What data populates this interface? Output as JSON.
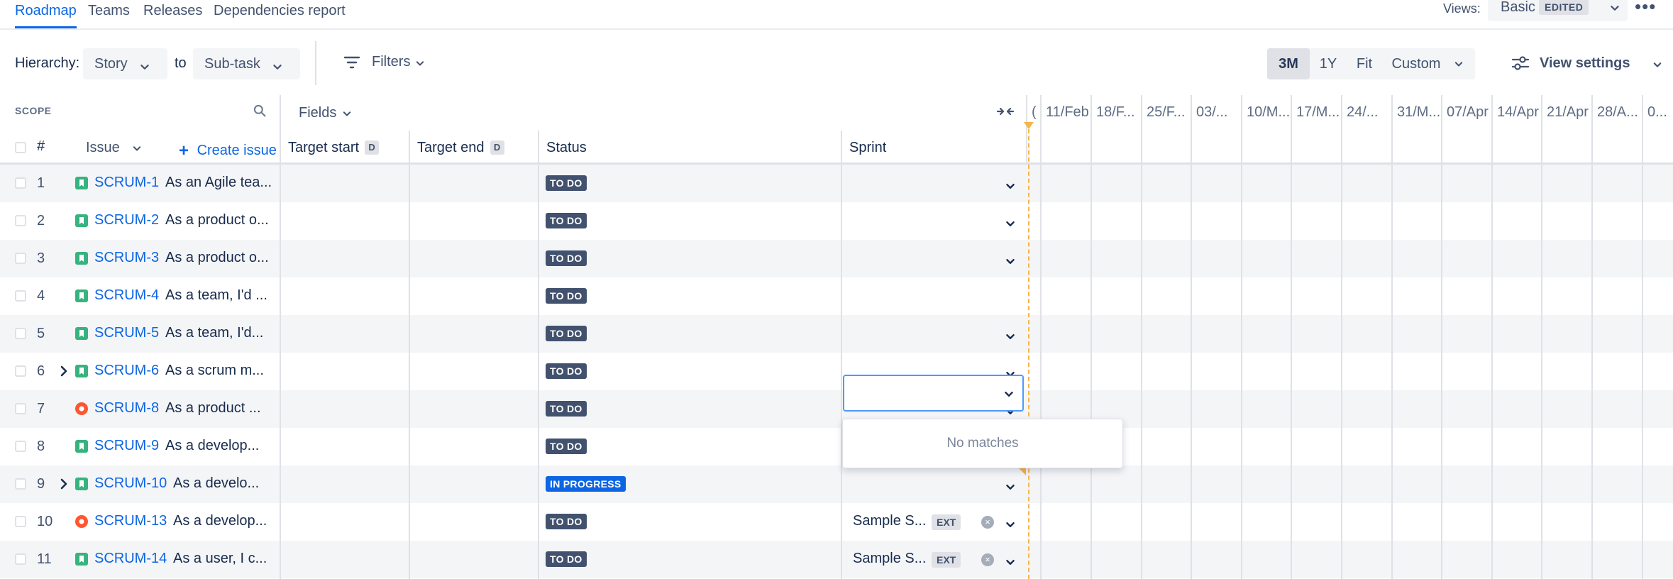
{
  "nav": {
    "tabs": [
      "Roadmap",
      "Teams",
      "Releases",
      "Dependencies report"
    ],
    "views_label": "Views:",
    "views_value": "Basic",
    "views_badge": "EDITED",
    "more": "•••"
  },
  "toolbar": {
    "hierarchy_label": "Hierarchy:",
    "from_value": "Story",
    "to_label": "to",
    "to_value": "Sub-task",
    "filters": "Filters",
    "zoom_options": [
      "3M",
      "1Y",
      "Fit",
      "Custom"
    ],
    "zoom_selected": "3M",
    "view_settings": "View settings"
  },
  "table": {
    "scope_label": "SCOPE",
    "fields_label": "Fields",
    "columns": {
      "num": "#",
      "issue": "Issue",
      "create": "Create issue",
      "target_start": "Target start",
      "target_end": "Target end",
      "date_badge": "D",
      "status": "Status",
      "sprint": "Sprint"
    },
    "timeline_dates": [
      "(",
      "11/Feb",
      "18/F...",
      "25/F...",
      "03/...",
      "10/M...",
      "17/M...",
      "24/...",
      "31/M...",
      "07/Apr",
      "14/Apr",
      "21/Apr",
      "28/A...",
      "0..."
    ],
    "rows": [
      {
        "num": "1",
        "key": "SCRUM-1",
        "summary": "As an Agile tea...",
        "type": "story",
        "expand": false,
        "status": "TO DO",
        "sprint": "",
        "ext": ""
      },
      {
        "num": "2",
        "key": "SCRUM-2",
        "summary": "As a product o...",
        "type": "story",
        "expand": false,
        "status": "TO DO",
        "sprint": "",
        "ext": ""
      },
      {
        "num": "3",
        "key": "SCRUM-3",
        "summary": "As a product o...",
        "type": "story",
        "expand": false,
        "status": "TO DO",
        "sprint": "",
        "ext": ""
      },
      {
        "num": "4",
        "key": "SCRUM-4",
        "summary": "As a team, I'd ...",
        "type": "story",
        "expand": false,
        "status": "TO DO",
        "sprint": "",
        "ext": ""
      },
      {
        "num": "5",
        "key": "SCRUM-5",
        "summary": "As a team, I'd...",
        "type": "story",
        "expand": false,
        "status": "TO DO",
        "sprint": "",
        "ext": ""
      },
      {
        "num": "6",
        "key": "SCRUM-6",
        "summary": "As a scrum m...",
        "type": "story",
        "expand": true,
        "status": "TO DO",
        "sprint": "",
        "ext": ""
      },
      {
        "num": "7",
        "key": "SCRUM-8",
        "summary": "As a product ...",
        "type": "bug",
        "expand": false,
        "status": "TO DO",
        "sprint": "",
        "ext": ""
      },
      {
        "num": "8",
        "key": "SCRUM-9",
        "summary": "As a develop...",
        "type": "story",
        "expand": false,
        "status": "TO DO",
        "sprint": "",
        "ext": ""
      },
      {
        "num": "9",
        "key": "SCRUM-10",
        "summary": "As a develo...",
        "type": "story",
        "expand": true,
        "status": "IN PROGRESS",
        "sprint": "",
        "ext": ""
      },
      {
        "num": "10",
        "key": "SCRUM-13",
        "summary": "As a develop...",
        "type": "bug",
        "expand": false,
        "status": "TO DO",
        "sprint": "Sample S...",
        "ext": "EXT"
      },
      {
        "num": "11",
        "key": "SCRUM-14",
        "summary": "As a user, I c...",
        "type": "story",
        "expand": false,
        "status": "TO DO",
        "sprint": "Sample S...",
        "ext": "EXT"
      }
    ],
    "sprint_dropdown_message": "No matches"
  },
  "colors": {
    "accent": "#0c66e4",
    "story": "#36b37e",
    "bug": "#ff5630",
    "todo": "#42526e",
    "in_progress": "#0c66e4",
    "today_marker": "#f8b54a"
  }
}
